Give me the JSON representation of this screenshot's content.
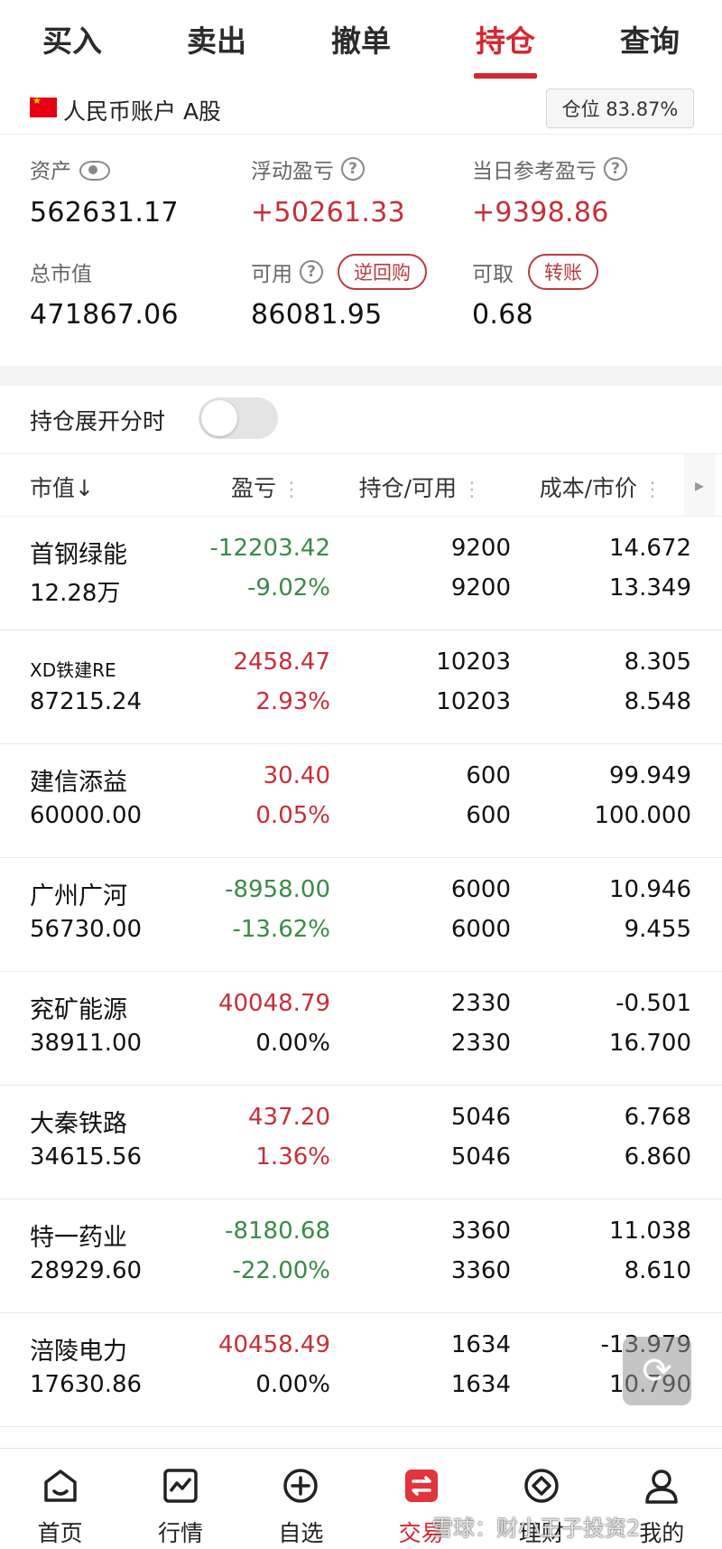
{
  "tabs": [
    {
      "label": "买入"
    },
    {
      "label": "卖出"
    },
    {
      "label": "撤单"
    },
    {
      "label": "持仓"
    },
    {
      "label": "查询"
    }
  ],
  "account": {
    "name": "人民币账户 A股",
    "position": "仓位 83.87%"
  },
  "summary": {
    "assets_label": "资产",
    "assets_value": "562631.17",
    "float_pl_label": "浮动盈亏",
    "float_pl_value": "+50261.33",
    "daily_pl_label": "当日参考盈亏",
    "daily_pl_value": "+9398.86",
    "market_value_label": "总市值",
    "market_value_value": "471867.06",
    "available_label": "可用",
    "available_value": "86081.95",
    "repo_button": "逆回购",
    "withdrawable_label": "可取",
    "withdrawable_value": "0.68",
    "transfer_button": "转账"
  },
  "expand_toggle": {
    "label": "持仓展开分时",
    "on": false
  },
  "table_header": {
    "market_value": "市值↓",
    "pl": "盈亏",
    "qty": "持仓/可用",
    "cost_price": "成本/市价"
  },
  "holdings": [
    {
      "name": "首钢绿能",
      "market_value": "12.28万",
      "pl": "-12203.42",
      "pl_pct": "-9.02%",
      "qty": "9200",
      "avail": "9200",
      "cost": "14.672",
      "price": "13.349",
      "sign": "neg"
    },
    {
      "name": "XD铁建RE",
      "market_value": "87215.24",
      "pl": "2458.47",
      "pl_pct": "2.93%",
      "qty": "10203",
      "avail": "10203",
      "cost": "8.305",
      "price": "8.548",
      "sign": "pos"
    },
    {
      "name": "建信添益",
      "market_value": "60000.00",
      "pl": "30.40",
      "pl_pct": "0.05%",
      "qty": "600",
      "avail": "600",
      "cost": "99.949",
      "price": "100.000",
      "sign": "pos"
    },
    {
      "name": "广州广河",
      "market_value": "56730.00",
      "pl": "-8958.00",
      "pl_pct": "-13.62%",
      "qty": "6000",
      "avail": "6000",
      "cost": "10.946",
      "price": "9.455",
      "sign": "neg"
    },
    {
      "name": "兖矿能源",
      "market_value": "38911.00",
      "pl": "40048.79",
      "pl_pct": "0.00%",
      "qty": "2330",
      "avail": "2330",
      "cost": "-0.501",
      "price": "16.700",
      "sign": "pos-zero"
    },
    {
      "name": "大秦铁路",
      "market_value": "34615.56",
      "pl": "437.20",
      "pl_pct": "1.36%",
      "qty": "5046",
      "avail": "5046",
      "cost": "6.768",
      "price": "6.860",
      "sign": "pos"
    },
    {
      "name": "特一药业",
      "market_value": "28929.60",
      "pl": "-8180.68",
      "pl_pct": "-22.00%",
      "qty": "3360",
      "avail": "3360",
      "cost": "11.038",
      "price": "8.610",
      "sign": "neg"
    },
    {
      "name": "涪陵电力",
      "market_value": "17630.86",
      "pl": "40458.49",
      "pl_pct": "0.00%",
      "qty": "1634",
      "avail": "1634",
      "cost": "-13.979",
      "price": "10.790",
      "sign": "pos-zero"
    }
  ],
  "nav": [
    {
      "label": "首页",
      "icon": "home-icon"
    },
    {
      "label": "行情",
      "icon": "chart-icon"
    },
    {
      "label": "自选",
      "icon": "plus-circle-icon"
    },
    {
      "label": "交易",
      "icon": "trade-icon"
    },
    {
      "label": "理财",
      "icon": "wealth-icon"
    },
    {
      "label": "我的",
      "icon": "user-icon"
    }
  ],
  "watermark": "雪球：财小王子投资2",
  "colors": {
    "accent": "#d6262f",
    "gain": "#c62f36",
    "loss": "#3b8a48"
  }
}
